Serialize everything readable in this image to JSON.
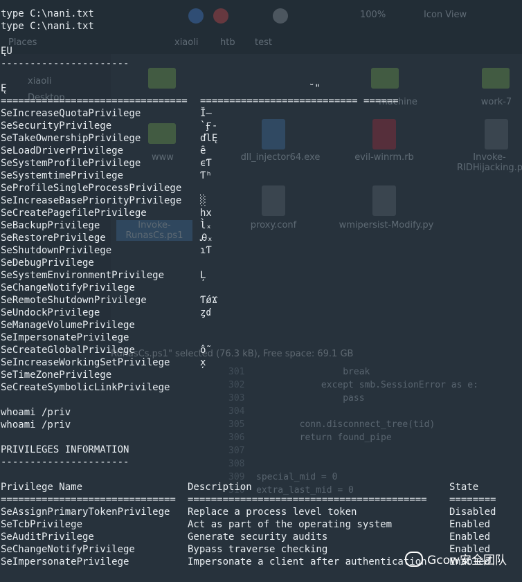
{
  "background": {
    "toolbar": {
      "zoom": "100%",
      "view": "Icon View"
    },
    "places_label": "Places",
    "breadcrumb": [
      "xiaoli",
      "htb",
      "test"
    ],
    "sidebar_items": [
      "xiaoli",
      "Desktop"
    ],
    "files": [
      {
        "name": "www",
        "kind": "folder"
      },
      {
        "name": "dll_injector64.exe",
        "kind": "app"
      },
      {
        "name": "evil-winrm.rb",
        "kind": "ruby"
      },
      {
        "name": "Invoke-RIDHijacking.ps1",
        "kind": "doc"
      },
      {
        "name": "Invoke-RunasCs.ps1",
        "kind": "doc"
      },
      {
        "name": "proxy.conf",
        "kind": "doc"
      },
      {
        "name": "wmipersist-Modify.py",
        "kind": "doc"
      },
      {
        "name": "work-7",
        "kind": "folder"
      },
      {
        "name": "machine",
        "kind": "folder"
      }
    ],
    "status_text": "RunasCs.ps1\" selected (76.3 kB), Free space: 69.1 GB",
    "code_lines": [
      {
        "n": "301",
        "t": "                break"
      },
      {
        "n": "302",
        "t": "            except smb.SessionError as e:"
      },
      {
        "n": "303",
        "t": "                pass"
      },
      {
        "n": "304",
        "t": ""
      },
      {
        "n": "305",
        "t": "        conn.disconnect_tree(tid)"
      },
      {
        "n": "306",
        "t": "        return found_pipe"
      },
      {
        "n": "307",
        "t": ""
      },
      {
        "n": "308",
        "t": ""
      },
      {
        "n": "309",
        "t": "special_mid = 0"
      },
      {
        "n": "310",
        "t": "extra_last_mid = 0"
      }
    ]
  },
  "terminal": {
    "cmd1": "type C:\\nani.txt",
    "cmd1_echo": "type C:\\nani.txt",
    "garbled_header": "ĘՍ",
    "dashes1": "----------------------",
    "garbled_e": "Ę",
    "garbled_mark": "˘\"",
    "separator_left": "================================",
    "separator_right": "=========================== ======",
    "privileges": [
      {
        "name": "SeIncreaseQuotaPrivilege",
        "garbled": "Ĭ–"
      },
      {
        "name": "SeSecurityPrivilege",
        "garbled": "`Ӻ-"
      },
      {
        "name": "SeTakeOwnershipPrivilege",
        "garbled": "ďlĘ"
      },
      {
        "name": "SeLoadDriverPrivilege",
        "garbled": "ȇ"
      },
      {
        "name": "SeSystemProfilePrivilege",
        "garbled": "ϵƬ"
      },
      {
        "name": "SeSystemtimePrivilege",
        "garbled": "Ƭʰ"
      },
      {
        "name": "SeProfileSingleProcessPrivilege",
        "garbled": ""
      },
      {
        "name": "SeIncreaseBasePriorityPrivilege",
        "garbled": "░"
      },
      {
        "name": "SeCreatePagefilePrivilege",
        "garbled": "hx"
      },
      {
        "name": "SeBackupPrivilege",
        "garbled": "l̀ₓ"
      },
      {
        "name": "SeRestorePrivilege",
        "garbled": "Ꭿₓ"
      },
      {
        "name": "SeShutdownPrivilege",
        "garbled": "ɿƬ"
      },
      {
        "name": "SeDebugPrivilege",
        "garbled": ""
      },
      {
        "name": "SeSystemEnvironmentPrivilege",
        "garbled": "Ļ"
      },
      {
        "name": "SeChangeNotifyPrivilege",
        "garbled": ""
      },
      {
        "name": "SeRemoteShutdownPrivilege",
        "garbled": "ƬǿϪ"
      },
      {
        "name": "SeUndockPrivilege",
        "garbled": "ȥɗ"
      },
      {
        "name": "SeManageVolumePrivilege",
        "garbled": ""
      },
      {
        "name": "SeImpersonatePrivilege",
        "garbled": ""
      },
      {
        "name": "SeCreateGlobalPrivilege",
        "garbled": "ỗ"
      },
      {
        "name": "SeIncreaseWorkingSetPrivilege",
        "garbled": "x̦"
      },
      {
        "name": "SeTimeZonePrivilege",
        "garbled": ""
      },
      {
        "name": "SeCreateSymbolicLinkPrivilege",
        "garbled": ""
      }
    ],
    "cmd2": "whoami /priv",
    "cmd2_echo": "whoami /priv",
    "info_title": "PRIVILEGES INFORMATION",
    "dashes2": "----------------------",
    "headers": {
      "name": "Privilege Name",
      "desc": "Description",
      "state": "State"
    },
    "sep_name": "==============================",
    "sep_desc": "=========================================",
    "sep_state": "========",
    "rows": [
      {
        "name": "SeAssignPrimaryTokenPrivilege",
        "desc": "Replace a process level token",
        "state": "Disabled"
      },
      {
        "name": "SeTcbPrivilege",
        "desc": "Act as part of the operating system",
        "state": "Enabled"
      },
      {
        "name": "SeAuditPrivilege",
        "desc": "Generate security audits",
        "state": "Enabled"
      },
      {
        "name": "SeChangeNotifyPrivilege",
        "desc": "Bypass traverse checking",
        "state": "Enabled"
      },
      {
        "name": "SeImpersonatePrivilege",
        "desc": "Impersonate a client after authentication",
        "state": "Enabled"
      }
    ]
  },
  "watermark": {
    "text": "Gcow安全团队"
  }
}
